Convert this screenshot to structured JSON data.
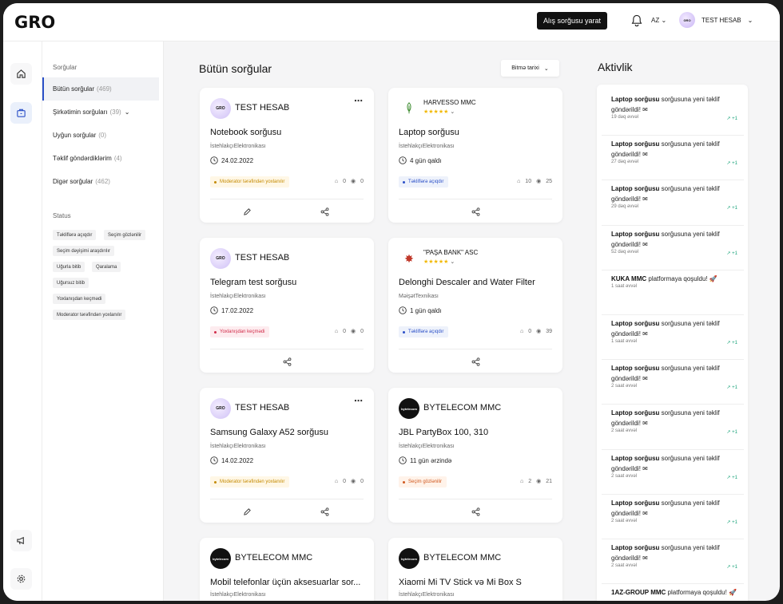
{
  "app": {
    "logo": "GRO"
  },
  "header": {
    "create_label": "Alış sorğusu yarat",
    "lang": "AZ",
    "user_name": "TEST HESAB",
    "avatar_text": "GRO"
  },
  "nav": {
    "section_title": "Sorğular",
    "items": [
      {
        "label": "Bütün sorğular",
        "count": "(469)"
      },
      {
        "label": "Şirkətimin sorğuları",
        "count": "(39)"
      },
      {
        "label": "Uyğun sorğular",
        "count": "(0)"
      },
      {
        "label": "Təklif göndərdiklərim",
        "count": "(4)"
      },
      {
        "label": "Digər sorğular",
        "count": "(462)"
      }
    ],
    "status_title": "Status",
    "statuses": [
      "Təkliflərə açıqdır",
      "Seçim gözlənilir",
      "Seçim dəyişimi araşdırılır",
      "Uğurla bitib",
      "Qaralama",
      "Uğursuz bitib",
      "Yoxlanışdan keçmədi",
      "Moderator tərəfindən yoxlanılır"
    ]
  },
  "main": {
    "title": "Bütün sorğular",
    "sort_label": "Bitmə tarixi",
    "cards": [
      {
        "owner": "TEST HESAB",
        "avatar": "GRO",
        "title": "Notebook sorğusu",
        "category": "İstehlakçıElektronikası",
        "date": "24.02.2022",
        "tag": "Moderator tərəfindən yoxlanılır",
        "likes": "0",
        "views": "0"
      },
      {
        "owner": "HARVESSO MMC",
        "avatar": "HARVESSO",
        "stars": "★★★★★",
        "title": "Laptop sorğusu",
        "category": "İstehlakçıElektronikası",
        "date": "4 gün qaldı",
        "tag": "Təkliflərə açıqdır",
        "likes": "10",
        "views": "25"
      },
      {
        "owner": "TEST HESAB",
        "avatar": "GRO",
        "title": "Telegram test sorğusu",
        "category": "İstehlakçıElektronikası",
        "date": "17.02.2022",
        "tag": "Yoxlanışdan keçmədi",
        "likes": "0",
        "views": "0"
      },
      {
        "owner": "\"PAŞA BANK\" ASC",
        "avatar": "✸",
        "stars": "★★★★★",
        "title": "Delonghi Descaler and Water Filter",
        "category": "MəişətTexnikası",
        "date": "1 gün qaldı",
        "tag": "Təkliflərə açıqdır",
        "likes": "0",
        "views": "39"
      },
      {
        "owner": "TEST HESAB",
        "avatar": "GRO",
        "title": "Samsung Galaxy A52 sorğusu",
        "category": "İstehlakçıElektronikası",
        "date": "14.02.2022",
        "tag": "Moderator tərəfindən yoxlanılır",
        "likes": "0",
        "views": "0"
      },
      {
        "owner": "BYTELECOM MMC",
        "avatar": "bytelecom",
        "title": "JBL PartyBox 100, 310",
        "category": "İstehlakçıElektronikası",
        "date": "11 gün ərzində",
        "tag": "Seçim gözlənilir",
        "likes": "2",
        "views": "21"
      },
      {
        "owner": "BYTELECOM MMC",
        "avatar": "bytelecom",
        "title": "Mobil telefonlar üçün aksesuarlar sor...",
        "category": "İstehlakçıElektronikası"
      },
      {
        "owner": "BYTELECOM MMC",
        "avatar": "bytelecom",
        "title": "Xiaomi Mi TV Stick və Mi Box S",
        "category": "İstehlakçıElektronikası"
      }
    ]
  },
  "activity": {
    "title": "Aktivlik",
    "items": [
      {
        "bold": "Laptop sorğusu",
        "text": " sorğusuna yeni təklif göndərildi! ✉",
        "time": "19 dəq əvvəl",
        "delta": "+1"
      },
      {
        "bold": "Laptop sorğusu",
        "text": " sorğusuna yeni təklif göndərildi! ✉",
        "time": "27 dəq əvvəl",
        "delta": "+1"
      },
      {
        "bold": "Laptop sorğusu",
        "text": " sorğusuna yeni təklif göndərildi! ✉",
        "time": "29 dəq əvvəl",
        "delta": "+1"
      },
      {
        "bold": "Laptop sorğusu",
        "text": " sorğusuna yeni təklif göndərildi! ✉",
        "time": "52 dəq əvvəl",
        "delta": "+1"
      },
      {
        "bold": "KUKA MMC",
        "text": " platformaya qoşuldu! 🚀",
        "time": "1 saat əvvəl",
        "delta": ""
      },
      {
        "bold": "Laptop sorğusu",
        "text": " sorğusuna yeni təklif göndərildi! ✉",
        "time": "1 saat əvvəl",
        "delta": "+1"
      },
      {
        "bold": "Laptop sorğusu",
        "text": " sorğusuna yeni təklif göndərildi! ✉",
        "time": "2 saat əvvəl",
        "delta": "+1"
      },
      {
        "bold": "Laptop sorğusu",
        "text": " sorğusuna yeni təklif göndərildi! ✉",
        "time": "2 saat əvvəl",
        "delta": "+1"
      },
      {
        "bold": "Laptop sorğusu",
        "text": " sorğusuna yeni təklif göndərildi! ✉",
        "time": "2 saat əvvəl",
        "delta": "+1"
      },
      {
        "bold": "Laptop sorğusu",
        "text": " sorğusuna yeni təklif göndərildi! ✉",
        "time": "2 saat əvvəl",
        "delta": "+1"
      },
      {
        "bold": "Laptop sorğusu",
        "text": " sorğusuna yeni təklif göndərildi! ✉",
        "time": "2 saat əvvəl",
        "delta": "+1"
      },
      {
        "bold": "1AZ-GROUP MMC",
        "text": " platformaya qoşuldu! 🚀",
        "time": "",
        "delta": ""
      }
    ]
  },
  "colors": {
    "accent": "#2a4fc7",
    "star": "#f2b800",
    "positive": "#1aa37a"
  }
}
